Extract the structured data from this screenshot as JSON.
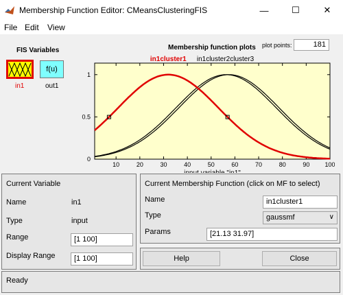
{
  "window": {
    "title": "Membership Function Editor: CMeansClusteringFIS",
    "minimize": "—",
    "maximize": "☐",
    "close": "✕"
  },
  "menu": [
    "File",
    "Edit",
    "View"
  ],
  "fis_variables": {
    "title": "FIS Variables",
    "input": {
      "label": "in1",
      "color": "#e00000"
    },
    "output": {
      "icon_text": "f(u)",
      "label": "out1"
    }
  },
  "plot": {
    "title": "Membership function plots",
    "plot_points_label": "plot points:",
    "plot_points_value": "181",
    "xlabel": "input variable \"in1\""
  },
  "chart_data": {
    "type": "line",
    "xlabel": "input variable \"in1\"",
    "x_ticks": [
      "10",
      "20",
      "30",
      "40",
      "50",
      "60",
      "70",
      "80",
      "90",
      "100"
    ],
    "y_ticks": [
      "0",
      "0.5",
      "1"
    ],
    "xlim": [
      1,
      100
    ],
    "ylim": [
      0,
      1
    ],
    "series": [
      {
        "name": "in1cluster1",
        "function": "gaussmf",
        "sigma": 21.13,
        "center": 31.97,
        "color": "#e00000",
        "selected": true
      },
      {
        "name": "in1cluster2",
        "function": "gaussmf",
        "sigma": 21.13,
        "center": 56.3,
        "color": "#000000",
        "selected": false
      },
      {
        "name": "in1cluster3",
        "function": "gaussmf",
        "sigma": 21.13,
        "center": 57.5,
        "color": "#000000",
        "selected": false
      }
    ],
    "label_texts": {
      "cluster1": "in1cluster1",
      "cluster2_3": "in1cluster2cluster3"
    },
    "grid": false
  },
  "current_variable": {
    "title": "Current Variable",
    "name_label": "Name",
    "name_value": "in1",
    "type_label": "Type",
    "type_value": "input",
    "range_label": "Range",
    "range_value": "[1 100]",
    "display_range_label": "Display Range",
    "display_range_value": "[1 100]"
  },
  "current_mf": {
    "title": "Current Membership Function (click on MF to select)",
    "name_label": "Name",
    "name_value": "in1cluster1",
    "type_label": "Type",
    "type_value": "gaussmf",
    "params_label": "Params",
    "params_value": "[21.13 31.97]"
  },
  "buttons": {
    "help": "Help",
    "close": "Close"
  },
  "status": "Ready"
}
